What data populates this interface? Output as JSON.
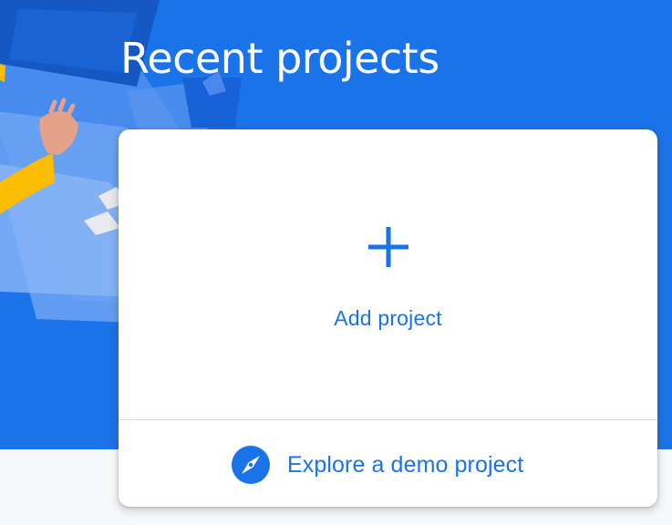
{
  "header": {
    "title": "Recent projects"
  },
  "card": {
    "add_project_label": "Add project",
    "demo_label": "Explore a demo project",
    "add_icon": "plus-icon",
    "demo_icon": "compass-icon"
  },
  "colors": {
    "brand_blue": "#1a73e8",
    "card_background": "#ffffff",
    "page_background": "#f8f9fa",
    "divider": "#dadce0"
  }
}
